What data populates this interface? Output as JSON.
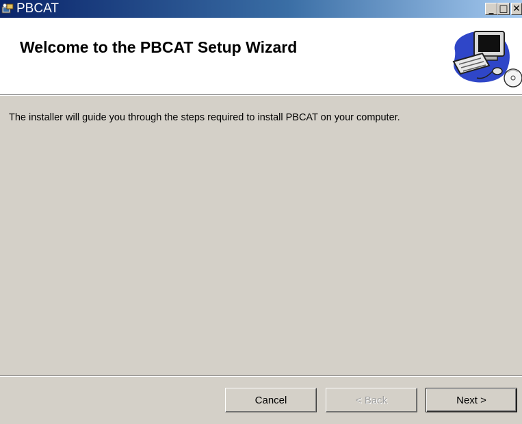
{
  "window": {
    "title": "PBCAT",
    "icon": "installer-icon",
    "controls": {
      "minimize": "_",
      "maximize": "□",
      "close": "✕"
    }
  },
  "banner": {
    "title": "Welcome to the PBCAT Setup Wizard",
    "art": "computer-cd-icon"
  },
  "body": {
    "intro": "The installer will guide you through the steps required to install PBCAT on your computer."
  },
  "buttons": {
    "cancel": "Cancel",
    "back": "< Back",
    "next": "Next >"
  },
  "colors": {
    "titlebar_start": "#0a246a",
    "titlebar_end": "#a6caf0",
    "dialog_bg": "#d4d0c8",
    "banner_bg": "#ffffff",
    "disabled_text": "#a0a0a0"
  }
}
